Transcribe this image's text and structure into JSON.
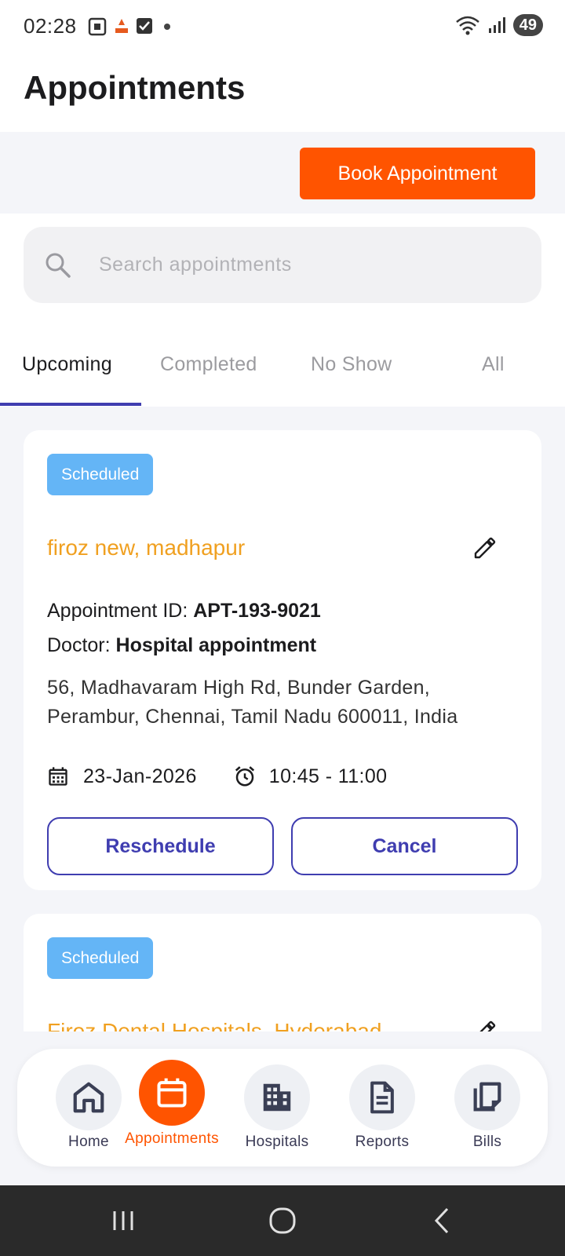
{
  "status_bar": {
    "time": "02:28",
    "battery": "49"
  },
  "header": {
    "title": "Appointments",
    "book_button": "Book Appointment"
  },
  "search": {
    "placeholder": "Search appointments",
    "value": ""
  },
  "tabs": [
    {
      "label": "Upcoming",
      "active": true
    },
    {
      "label": "Completed",
      "active": false
    },
    {
      "label": "No Show",
      "active": false
    },
    {
      "label": "All",
      "active": false
    }
  ],
  "appointments": [
    {
      "status": "Scheduled",
      "hospital": "firoz new, madhapur",
      "id_label": "Appointment ID: ",
      "id": "APT-193-9021",
      "doctor_label": "Doctor: ",
      "doctor": "Hospital appointment",
      "address": "56, Madhavaram High Rd, Bunder Garden, Perambur, Chennai, Tamil Nadu 600011, India",
      "date": "23-Jan-2026",
      "time": "10:45 - 11:00",
      "reschedule_label": "Reschedule",
      "cancel_label": "Cancel"
    },
    {
      "status": "Scheduled",
      "hospital": "Firoz Dental Hospitals, Hyderabad"
    }
  ],
  "bottom_nav": [
    {
      "label": "Home",
      "icon": "home-icon",
      "active": false
    },
    {
      "label": "Appointments",
      "icon": "calendar-icon",
      "active": true
    },
    {
      "label": "Hospitals",
      "icon": "building-icon",
      "active": false
    },
    {
      "label": "Reports",
      "icon": "document-icon",
      "active": false
    },
    {
      "label": "Bills",
      "icon": "copy-icon",
      "active": false
    }
  ],
  "colors": {
    "accent": "#ff5400",
    "primary": "#3f3db0",
    "badge": "#64b5f6",
    "hospital_name": "#f0a020"
  }
}
